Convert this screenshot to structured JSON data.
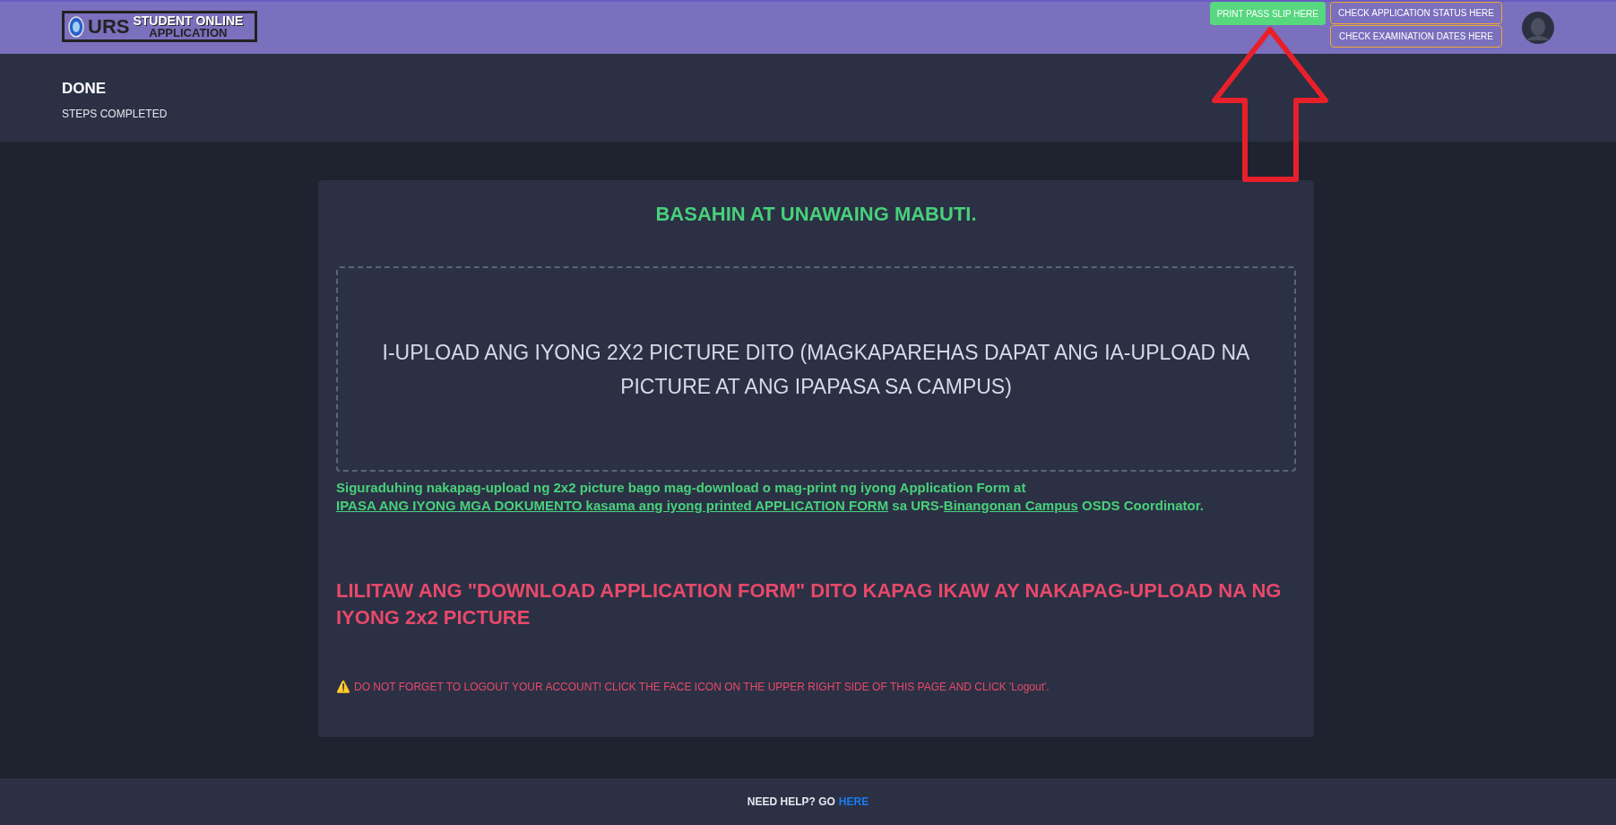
{
  "header": {
    "logo": {
      "initials": "URS",
      "line1": "STUDENT ONLINE",
      "line2": "APPLICATION"
    },
    "buttons": [
      {
        "label": "PRINT PASS SLIP HERE",
        "kind": "filled"
      },
      {
        "label": "CHECK APPLICATION STATUS HERE",
        "kind": "outline"
      },
      {
        "label": "CHECK EXAMINATION DATES HERE",
        "kind": "outline"
      }
    ]
  },
  "hero": {
    "title": "DONE",
    "subtitle": "STEPS COMPLETED"
  },
  "card": {
    "heading": "BASAHIN AT UNAWAING MABUTI.",
    "upload_prompt": "I-UPLOAD ANG IYONG 2X2 PICTURE DITO (MAGKAPAREHAS DAPAT ANG IA-UPLOAD NA PICTURE AT ANG IPAPASA SA CAMPUS)",
    "note": [
      {
        "text": "Siguraduhing nakapag-upload ng 2x2 picture bago mag-download o mag-print ng iyong Application Form at ",
        "link": false
      },
      {
        "text": "IPASA ANG IYONG MGA DOKUMENTO kasama ang iyong printed APPLICATION FORM",
        "link": true
      },
      {
        "text": " sa URS-",
        "link": false
      },
      {
        "text": "Binangonan Campus",
        "link": true
      },
      {
        "text": " OSDS Coordinator.",
        "link": false
      }
    ],
    "download_notice": "LILITAW ANG \"DOWNLOAD APPLICATION FORM\" DITO KAPAG IKAW AY NAKAPAG-UPLOAD NA NG IYONG 2x2 PICTURE",
    "warning_icon": "⚠️",
    "warning": "DO NOT FORGET TO LOGOUT YOUR ACCOUNT! CLICK THE FACE ICON ON THE UPPER RIGHT SIDE OF THIS PAGE AND CLICK 'Logout'."
  },
  "footer": {
    "text": "NEED HELP? GO",
    "link": "HERE"
  }
}
